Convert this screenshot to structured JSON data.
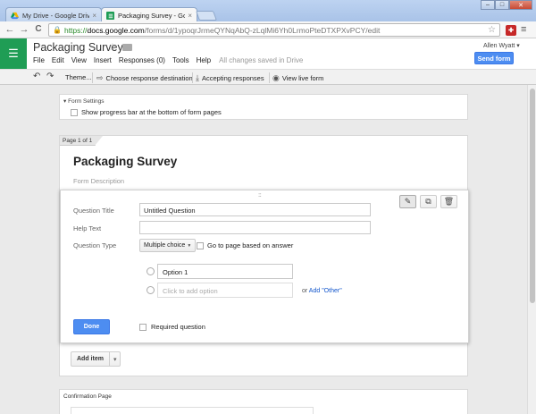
{
  "browser": {
    "tabs": [
      {
        "label": "My Drive - Google Drive",
        "icon": "google-drive-icon",
        "close": "×"
      },
      {
        "label": "Packaging Survey - Goog",
        "icon": "google-forms-icon",
        "close": "×"
      }
    ],
    "window_controls": {
      "minimize": "–",
      "maximize": "□",
      "close": "✕"
    },
    "nav": {
      "back": "←",
      "forward": "→",
      "reload": "C"
    },
    "url": {
      "scheme": "https://",
      "host": "docs.google.com",
      "path": "/forms/d/1ypoqrJrmeQYNqAbQ-zLqlMi6Yh0LrmoPteDTXPXvPCY/edit"
    },
    "bookmark_star": "☆",
    "menu_glyph": "≡"
  },
  "app": {
    "logo_glyph": "☰",
    "title": "Packaging Survey",
    "star_glyph": "☆",
    "menus": [
      "File",
      "Edit",
      "View",
      "Insert",
      "Responses (0)",
      "Tools",
      "Help"
    ],
    "save_status": "All changes saved in Drive",
    "user": "Allen Wyatt",
    "send_label": "Send form"
  },
  "form_toolbar": {
    "undo": "↶",
    "redo": "↷",
    "theme": "Theme...",
    "destination": "Choose response destination",
    "accepting": "Accepting responses",
    "live_form": "View live form"
  },
  "form_settings": {
    "header": "▾ Form Settings",
    "progress_label": "Show progress bar at the bottom of form pages",
    "progress_checked": false
  },
  "page": {
    "tag": "Page 1 of 1",
    "title": "Packaging Survey",
    "description_placeholder": "Form Description",
    "add_item_label": "Add item",
    "add_item_arrow": "▾"
  },
  "question_editor": {
    "drag_handle": "::::",
    "tool_icons": [
      "pencil-icon",
      "copy-icon",
      "trash-icon"
    ],
    "title_label": "Question Title",
    "title_value": "Untitled Question",
    "help_label": "Help Text",
    "help_value": "",
    "type_label": "Question Type",
    "type_value": "Multiple choice",
    "type_caret": "▼",
    "goto_label": "Go to page based on answer",
    "options": [
      "Option 1"
    ],
    "add_option_placeholder": "Click to add option",
    "or_text": "or",
    "add_other_label": "Add \"Other\"",
    "done_label": "Done",
    "required_label": "Required question"
  },
  "confirmation": {
    "header": "Confirmation Page"
  }
}
